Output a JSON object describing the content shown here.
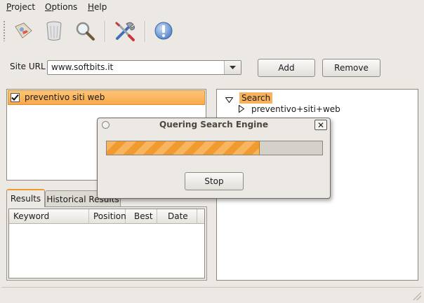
{
  "menu": {
    "project": {
      "ul": "P",
      "rest": "roject"
    },
    "options": {
      "ul": "O",
      "rest": "ptions"
    },
    "help": {
      "ul": "H",
      "rest": "elp"
    }
  },
  "toolbar": {
    "icons": [
      "new-site-icon",
      "trash-icon",
      "search-icon",
      "tools-icon",
      "info-icon"
    ]
  },
  "site_url": {
    "label": "Site URL",
    "value": "www.softbits.it",
    "add_label": "Add",
    "remove_label": "Remove"
  },
  "sites": [
    {
      "label": "preventivo siti web",
      "checked": true
    }
  ],
  "tabs": {
    "results": "Results",
    "historical": "Historical Results"
  },
  "table": {
    "columns": [
      "Keyword",
      "Position",
      "Best",
      "Date"
    ]
  },
  "tree": {
    "root": "Search",
    "child": "preventivo+siti+web"
  },
  "dialog": {
    "title": "Quering Search Engine",
    "close": "✕",
    "progress": 0.71,
    "stop_label": "Stop"
  },
  "colors": {
    "accent": "#f8b25c",
    "window_bg": "#ece9e5"
  }
}
